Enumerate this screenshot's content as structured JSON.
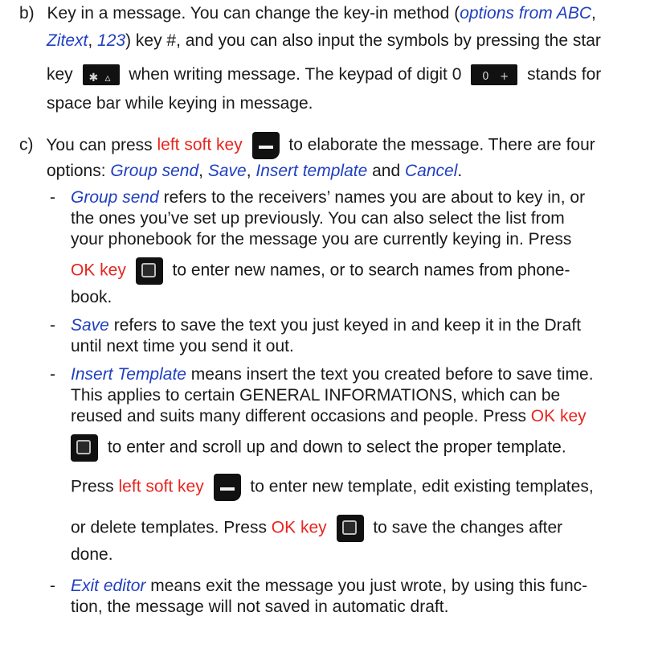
{
  "b": {
    "marker": "b)",
    "l1": "Key in a message. You can change the key-in method (",
    "l1_link": "options from ABC",
    "l1_end": ",",
    "l2_link1": "Zitext",
    "l2_sep": ", ",
    "l2_link2": "123",
    "l2_rest": ") key #, and you can also input the symbols by pressing the star",
    "l3_a": "key",
    "l3_b": "when writing message. The keypad of digit 0",
    "l3_c": "stands for",
    "l4": "space bar while keying in message."
  },
  "c": {
    "marker": "c)",
    "l1_a": "You can press ",
    "l1_red": "left soft key",
    "l1_b": "to elaborate the message. There are four",
    "l2_a": "options: ",
    "opt1": "Group send",
    "sep1": ", ",
    "opt2": "Save",
    "sep2": ", ",
    "opt3": "Insert template",
    "and": " and ",
    "opt4": "Cancel",
    "end": "."
  },
  "items": {
    "dash": "-",
    "gs_title": "Group send",
    "gs_l1": " refers to the receivers’ names you are about to key in, or",
    "gs_l2": "the ones you’ve set up previously. You can also select the list from",
    "gs_l3": "your phonebook for the message you are currently keying in. Press",
    "gs_ok": "OK key",
    "gs_l4b": "to enter new names, or to search names from phone-",
    "gs_l5": "book.",
    "save_title": "Save",
    "save_l1": " refers to save the text you just keyed in and keep it in the Draft",
    "save_l2": "until next time you send it out.",
    "it_title": "Insert Template",
    "it_l1": " means insert the text you created before to save time.",
    "it_l2": "This applies to certain GENERAL INFORMATIONS, which can be",
    "it_l3a": "reused and suits many different occasions and people. Press ",
    "it_l3_ok": "OK key",
    "it_l4": "to enter and scroll up and down to select the proper template.",
    "it_l5a": "Press ",
    "it_l5_red": "left soft key",
    "it_l5b": "to enter new template, edit existing templates,",
    "it_l6a": "or delete templates. Press ",
    "it_l6_ok": "OK key",
    "it_l6b": "to save the changes after",
    "it_l7": "done.",
    "ex_title": "Exit editor",
    "ex_l1": " means exit the message you just wrote, by using this func-",
    "ex_l2": "tion, the message will not saved in automatic draft."
  },
  "keys": {
    "star": "✱",
    "alpha": "▵",
    "zero": "0",
    "plus": "+"
  },
  "colors": {
    "text": "#1a1a1a",
    "link": "#1f3fbf",
    "highlight": "#e8251f"
  }
}
